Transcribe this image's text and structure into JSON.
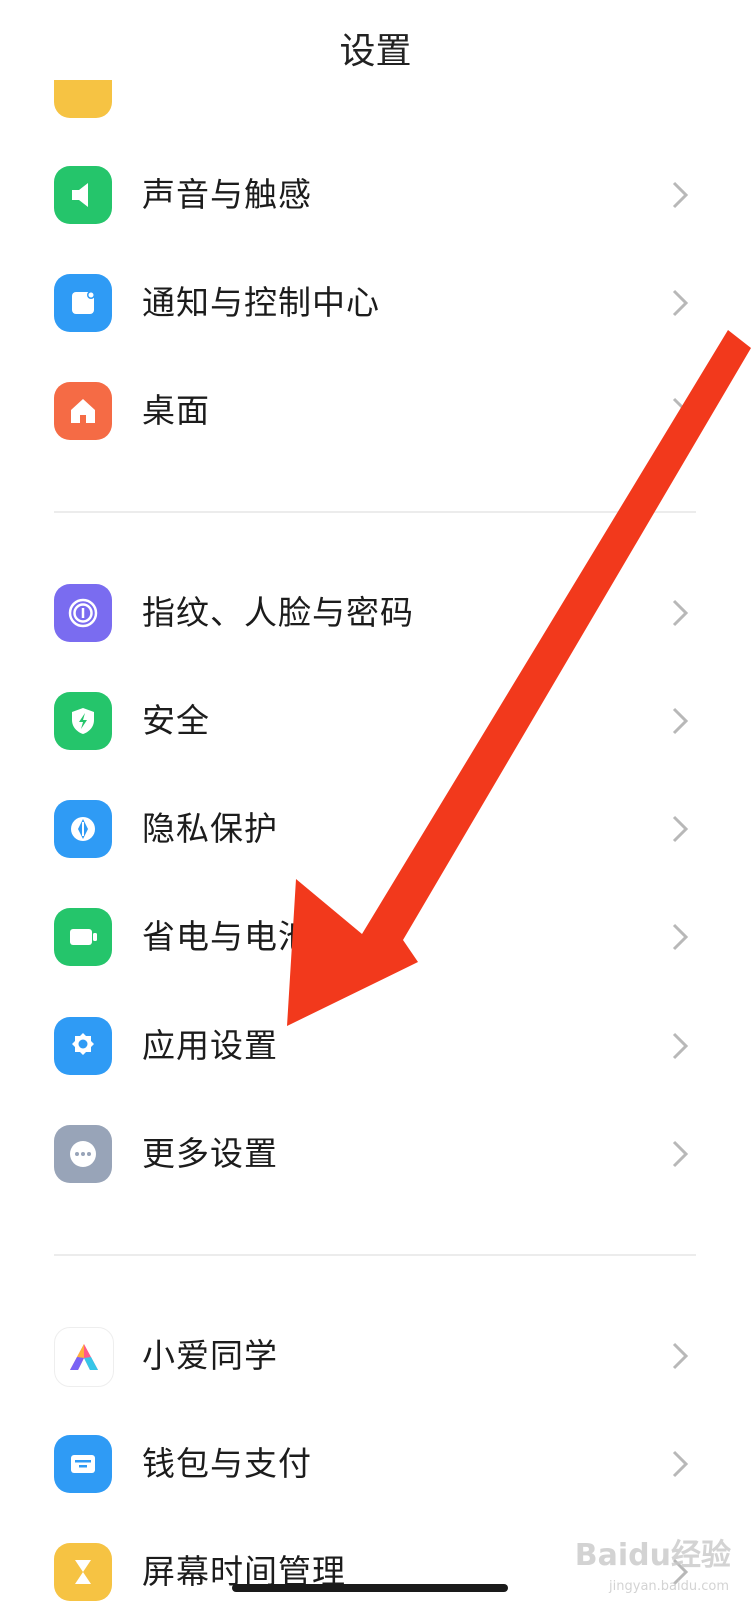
{
  "header": {
    "title": "设置"
  },
  "items": [
    {
      "label": "声音与触感",
      "icon": "speaker-icon",
      "color": "#25c56b"
    },
    {
      "label": "通知与控制中心",
      "icon": "notification-icon",
      "color": "#2f9bf5"
    },
    {
      "label": "桌面",
      "icon": "home-icon",
      "color": "#f56b45"
    },
    {
      "label": "指纹、人脸与密码",
      "icon": "fingerprint-icon",
      "color": "#7a6cf0"
    },
    {
      "label": "安全",
      "icon": "shield-icon",
      "color": "#25c56b"
    },
    {
      "label": "隐私保护",
      "icon": "privacy-icon",
      "color": "#2f9bf5"
    },
    {
      "label": "省电与电池",
      "icon": "battery-icon",
      "color": "#25c56b"
    },
    {
      "label": "应用设置",
      "icon": "gear-icon",
      "color": "#2f9bf5"
    },
    {
      "label": "更多设置",
      "icon": "more-icon",
      "color": "#98a4b8"
    },
    {
      "label": "小爱同学",
      "icon": "xiaoai-icon",
      "color": "#ffffff"
    },
    {
      "label": "钱包与支付",
      "icon": "wallet-icon",
      "color": "#2f9bf5"
    },
    {
      "label": "屏幕时间管理",
      "icon": "hourglass-icon",
      "color": "#f6c343"
    }
  ],
  "annotation": {
    "arrow_color": "#f2391c"
  },
  "watermark": {
    "text": "Baidu经验",
    "sub": "jingyan.baidu.com"
  }
}
